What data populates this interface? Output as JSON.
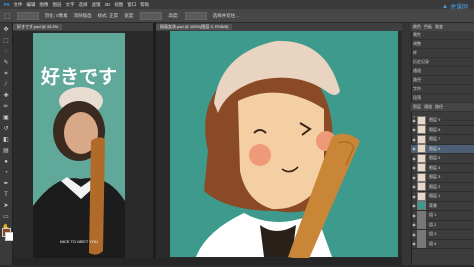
{
  "app": {
    "logo_text": "Ps"
  },
  "menu": [
    "文件",
    "编辑",
    "图像",
    "图层",
    "文字",
    "选择",
    "滤镜",
    "3D",
    "视图",
    "窗口",
    "帮助"
  ],
  "options_bar": {
    "items": [
      "羽化: 0像素",
      "消除锯齿",
      "样式: 正常",
      "宽度:",
      "高度:",
      "选择并遮住..."
    ]
  },
  "doc_tabs_left": [
    {
      "label": "好きです.psd @ 33.3%",
      "active": true
    }
  ],
  "doc_tabs_right": [
    {
      "label": "插画女孩.psd @ 100%(图层 3, RGB/8)",
      "active": true
    }
  ],
  "poster": {
    "title": "好きです",
    "bottom_text": "NICE TO MEET YOU"
  },
  "watermark": {
    "text": "虎课网"
  },
  "right_panel": {
    "tabs": [
      "颜色",
      "色板",
      "渐变"
    ],
    "rows": [
      "属性",
      "调整",
      "库",
      "历史记录",
      "通道",
      "路径",
      "字符",
      "段落"
    ],
    "layer_tabs": [
      "图层",
      "通道",
      "路径"
    ],
    "layers": [
      "图层 9",
      "图层 8",
      "图层 7",
      "图层 6",
      "图层 5",
      "图层 4",
      "图层 3",
      "图层 2",
      "图层 1",
      "背景",
      "组 1",
      "组 2",
      "组 3",
      "组 4",
      "组 5"
    ]
  },
  "colors": {
    "poster_bg": "#5fa89a",
    "canvas_bg": "#3f9a8e",
    "hair": "#8b4a26",
    "skin": "#f5cfa4",
    "bat": "#c88636",
    "hat": "#e8d4c0",
    "selected_layer": "#4d5f77"
  }
}
